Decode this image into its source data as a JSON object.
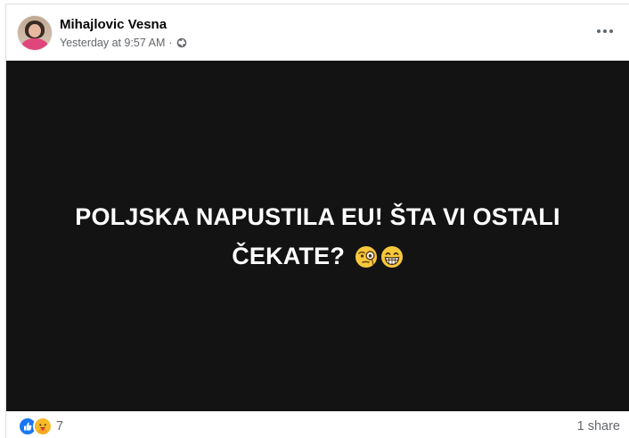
{
  "post": {
    "author": "Mihajlovic Vesna",
    "timestamp": "Yesterday at 9:57 AM",
    "separator": "·",
    "privacy_icon": "globe-icon",
    "more_icon": "more-options-icon",
    "media_text": "POLJSKA NAPUSTILA EU! ŠTA VI OSTALI ČEKATE?",
    "media_emojis": [
      "face-with-monocle-emoji",
      "grinning-face-emoji"
    ],
    "reaction_icons": [
      "like-icon",
      "care-icon"
    ],
    "reaction_count": "7",
    "shares": "1 share"
  },
  "colors": {
    "media_background": "#131313",
    "text_primary": "#050505",
    "text_secondary": "#65676b",
    "like_blue": "#1877f2",
    "care_yellow": "#f7b928"
  }
}
